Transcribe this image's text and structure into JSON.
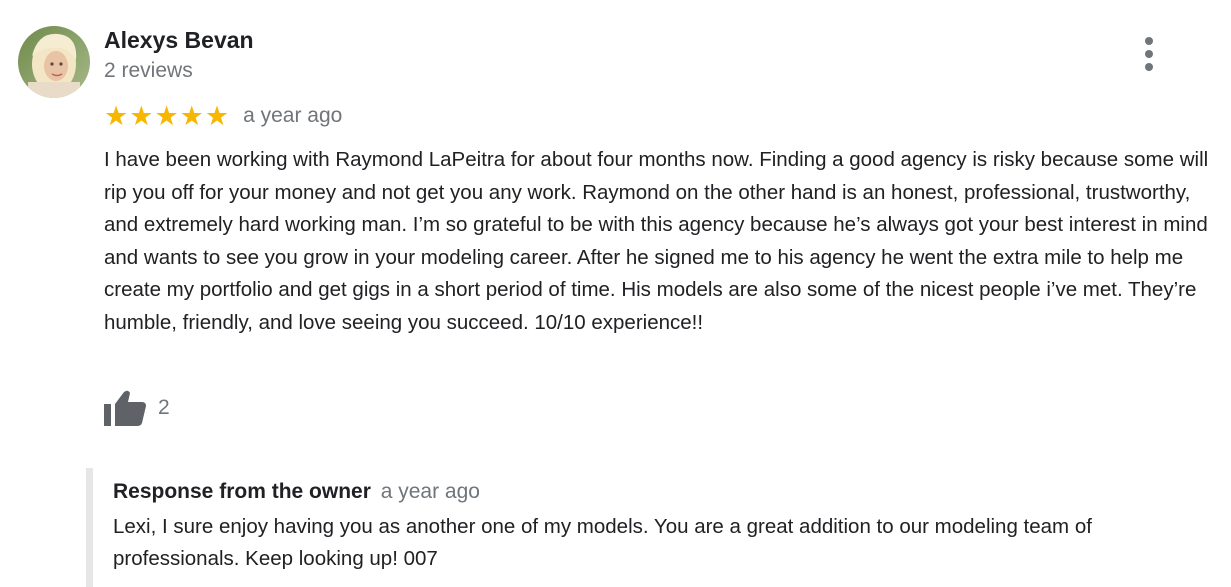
{
  "reviewer": {
    "name": "Alexys Bevan",
    "review_count": "2 reviews",
    "avatar_icon": "profile-photo"
  },
  "review": {
    "rating": 5,
    "rating_max": 5,
    "stars": [
      "★",
      "★",
      "★",
      "★",
      "★"
    ],
    "star_color": "#f7b600",
    "age": "a year ago",
    "text": "I have been working with Raymond LaPeitra for about four months now. Finding a good agency is risky because some will rip you off for your money and not get you any work. Raymond on the other hand is an honest, professional, trustworthy, and extremely hard working man. I’m so grateful to be with this agency because he’s always got your best interest in mind and wants to see you grow in your modeling career. After he signed me to his agency he went the extra mile to help me create my portfolio and get gigs in a short period of time. His models are also some of the nicest people i’ve met. They’re humble, friendly, and love seeing you succeed. 10/10 experience!!",
    "likes": "2"
  },
  "owner_response": {
    "label": "Response from the owner",
    "age": "a year ago",
    "text": "Lexi, I sure enjoy having you as another one of my models. You are a great addition to our modeling team of professionals. Keep looking up! 007"
  },
  "icons": {
    "more": "more-vert-icon",
    "like": "thumbs-up-icon"
  },
  "colors": {
    "text_primary": "#202124",
    "text_secondary": "#70757a",
    "response_border": "#e6e6e6"
  }
}
